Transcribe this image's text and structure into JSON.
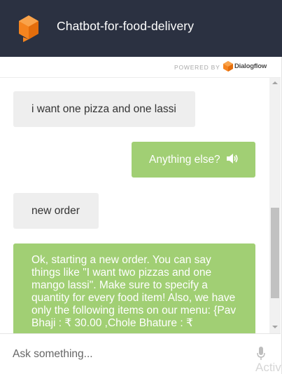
{
  "header": {
    "title": "Chatbot-for-food-delivery",
    "logo_icon": "dialogflow-cube-icon",
    "bg_color": "#2b3141"
  },
  "powered_by": {
    "label": "POWERED BY",
    "brand": "Dialogflow",
    "brand_icon": "dialogflow-logo-icon",
    "brand_color": "#f5841f"
  },
  "messages": [
    {
      "sender": "user",
      "text": "i want one pizza and one lassi"
    },
    {
      "sender": "bot",
      "text": "Anything else?",
      "icon": "speaker-icon"
    },
    {
      "sender": "user",
      "text": "new order"
    },
    {
      "sender": "bot",
      "text": "Ok, starting a new order. You can say things like \"I want two pizzas and one mango lassi\". Make sure to specify a quantity for every food item! Also, we have only the following items on our menu: {Pav Bhaji : ₹ 30.00 ,Chole Bhature : ₹"
    }
  ],
  "colors": {
    "user_bubble": "#eeeeee",
    "bot_bubble": "#a1cf74"
  },
  "input": {
    "placeholder": "Ask something...",
    "value": "",
    "mic_icon": "microphone-icon"
  },
  "watermark": "Activ"
}
